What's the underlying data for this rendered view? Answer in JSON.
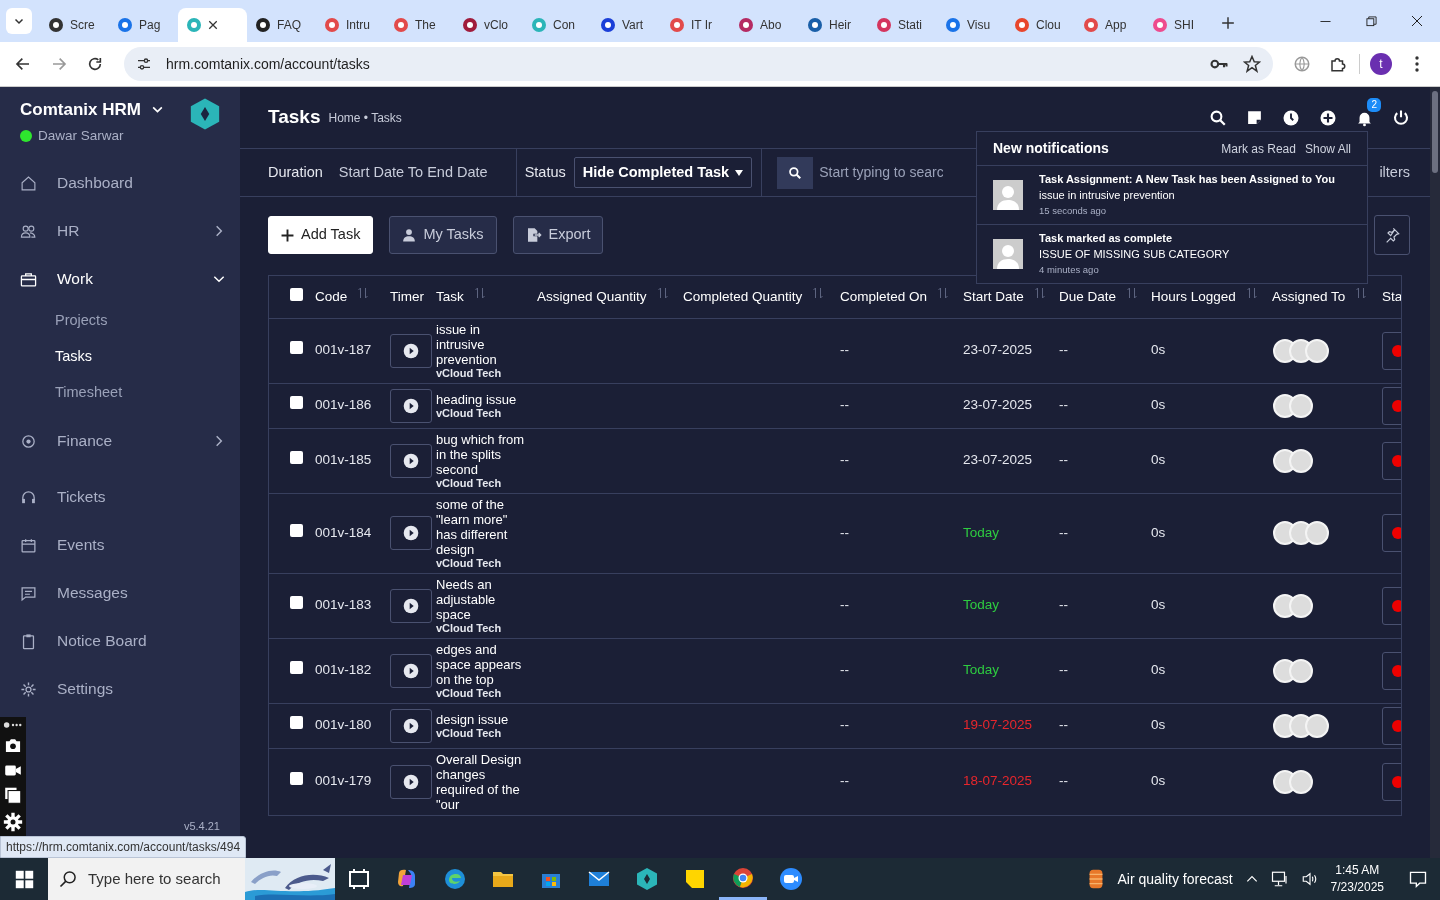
{
  "browser": {
    "tabs": [
      {
        "title": "Scre",
        "selected": false
      },
      {
        "title": "Pag",
        "selected": false
      },
      {
        "selected": true
      },
      {
        "title": "FAQ",
        "selected": false
      },
      {
        "title": "Intru",
        "selected": false
      },
      {
        "title": "The",
        "selected": false
      },
      {
        "title": "vClo",
        "selected": false
      },
      {
        "title": "Con",
        "selected": false
      },
      {
        "title": "Vart",
        "selected": false
      },
      {
        "title": "IT Ir",
        "selected": false
      },
      {
        "title": "Abo",
        "selected": false
      },
      {
        "title": "Heir",
        "selected": false
      },
      {
        "title": "Stati",
        "selected": false
      },
      {
        "title": "Visu",
        "selected": false
      },
      {
        "title": "Clou",
        "selected": false
      },
      {
        "title": "App",
        "selected": false
      },
      {
        "title": "SHI",
        "selected": false
      }
    ],
    "address": "hrm.comtanix.com/account/tasks",
    "profile_initial": "t"
  },
  "sidebar": {
    "brand": "Comtanix HRM",
    "user": "Dawar Sarwar",
    "user_online": true,
    "items": [
      {
        "label": "Dashboard",
        "selected": false
      },
      {
        "label": "HR",
        "selected": false,
        "expanded": false
      },
      {
        "label": "Work",
        "selected": true,
        "expanded": true,
        "children": [
          {
            "label": "Projects",
            "selected": false
          },
          {
            "label": "Tasks",
            "selected": true
          },
          {
            "label": "Timesheet",
            "selected": false
          }
        ]
      },
      {
        "label": "Finance",
        "selected": false,
        "expanded": false
      },
      {
        "label": "Tickets",
        "selected": false
      },
      {
        "label": "Events",
        "selected": false
      },
      {
        "label": "Messages",
        "selected": false
      },
      {
        "label": "Notice Board",
        "selected": false
      },
      {
        "label": "Settings",
        "selected": false
      }
    ],
    "version": "v5.4.21"
  },
  "header": {
    "title": "Tasks",
    "breadcrumb": "Home • Tasks",
    "notification_count": "2"
  },
  "filters": {
    "duration_label": "Duration",
    "duration_value": "Start Date To End Date",
    "status_label": "Status",
    "status_value": "Hide Completed Task",
    "search_placeholder": "Start typing to searc",
    "filters_button": "ilters"
  },
  "actions": [
    "Add Task",
    "My Tasks",
    "Export"
  ],
  "table": {
    "select_all_checked": false,
    "columns": [
      {
        "label": "Code",
        "sortable": true
      },
      {
        "label": "Timer",
        "sortable": false
      },
      {
        "label": "Task",
        "sortable": true
      },
      {
        "label": "Assigned Quantity",
        "sortable": true
      },
      {
        "label": "Completed Quantity",
        "sortable": true
      },
      {
        "label": "Completed On",
        "sortable": true
      },
      {
        "label": "Start Date",
        "sortable": true
      },
      {
        "label": "Due Date",
        "sortable": true
      },
      {
        "label": "Hours Logged",
        "sortable": true
      },
      {
        "label": "Assigned To",
        "sortable": true
      },
      {
        "label": "Sta",
        "sortable": false
      }
    ],
    "rows": [
      {
        "checked": false,
        "code": "001v-187",
        "task": "issue in intrusive prevention",
        "company": "vCloud Tech",
        "completed_on": "--",
        "start_date": "23-07-2025",
        "color": "#e6e8ef",
        "due_date": "--",
        "hours": "0s",
        "assignees": [
          {
            "kind": "avatar"
          },
          {
            "kind": "avatar"
          },
          {
            "kind": "avatar"
          }
        ]
      },
      {
        "checked": false,
        "code": "001v-186",
        "task": "heading issue",
        "company": "vCloud Tech",
        "completed_on": "--",
        "start_date": "23-07-2025",
        "color": "#e6e8ef",
        "due_date": "--",
        "hours": "0s",
        "assignees": [
          {
            "kind": "avatar"
          },
          {
            "kind": "avatar"
          }
        ]
      },
      {
        "checked": false,
        "code": "001v-185",
        "task": "bug which from in the splits second",
        "company": "vCloud Tech",
        "completed_on": "--",
        "start_date": "23-07-2025",
        "color": "#e6e8ef",
        "due_date": "--",
        "hours": "0s",
        "assignees": [
          {
            "kind": "avatar"
          },
          {
            "kind": "avatar"
          }
        ]
      },
      {
        "checked": false,
        "code": "001v-184",
        "task": "some of the \"learn more\" has different design",
        "company": "vCloud Tech",
        "completed_on": "--",
        "start_date": "Today",
        "color": "#2ecc40",
        "due_date": "--",
        "hours": "0s",
        "assignees": [
          {
            "kind": "avatar"
          },
          {
            "kind": "avatar"
          },
          {
            "kind": "avatar"
          }
        ]
      },
      {
        "checked": false,
        "code": "001v-183",
        "task": "Needs an adjustable space",
        "company": "vCloud Tech",
        "completed_on": "--",
        "start_date": "Today",
        "color": "#2ecc40",
        "due_date": "--",
        "hours": "0s",
        "assignees": [
          {
            "kind": "avatar"
          },
          {
            "kind": "avatar"
          }
        ]
      },
      {
        "checked": false,
        "code": "001v-182",
        "task": "edges and space appears on the top",
        "company": "vCloud Tech",
        "completed_on": "--",
        "start_date": "Today",
        "color": "#2ecc40",
        "due_date": "--",
        "hours": "0s",
        "assignees": [
          {
            "kind": "avatar"
          },
          {
            "kind": "avatar"
          }
        ]
      },
      {
        "checked": false,
        "code": "001v-180",
        "task": "design issue",
        "company": "vCloud Tech",
        "completed_on": "--",
        "start_date": "19-07-2025",
        "color": "#e8262c",
        "due_date": "--",
        "hours": "0s",
        "assignees": [
          {
            "kind": "avatar"
          },
          {
            "kind": "avatar"
          },
          {
            "kind": "avatar"
          }
        ]
      },
      {
        "checked": false,
        "code": "001v-179",
        "task": "Overall Design changes required of the \"our",
        "completed_on": "--",
        "start_date": "18-07-2025",
        "color": "#e8262c",
        "due_date": "--",
        "hours": "0s",
        "assignees": [
          {
            "kind": "avatar"
          },
          {
            "kind": "avatar"
          }
        ]
      }
    ]
  },
  "notifications": {
    "title": "New notifications",
    "mark_read": "Mark as Read",
    "show_all": "Show All",
    "items": [
      {
        "title": "Task Assignment: A New Task has been Assigned to You",
        "detail": "issue in intrusive prevention",
        "time": "15 seconds ago"
      },
      {
        "title": "Task marked as complete",
        "detail": "ISSUE OF MISSING SUB CATEGORY",
        "time": "4 minutes ago"
      }
    ]
  },
  "status_url": "https://hrm.comtanix.com/account/tasks/494",
  "taskbar": {
    "search_placeholder": "Type here to search",
    "weather": "Air quality forecast",
    "time": "1:45 AM",
    "date": "7/23/2025"
  }
}
